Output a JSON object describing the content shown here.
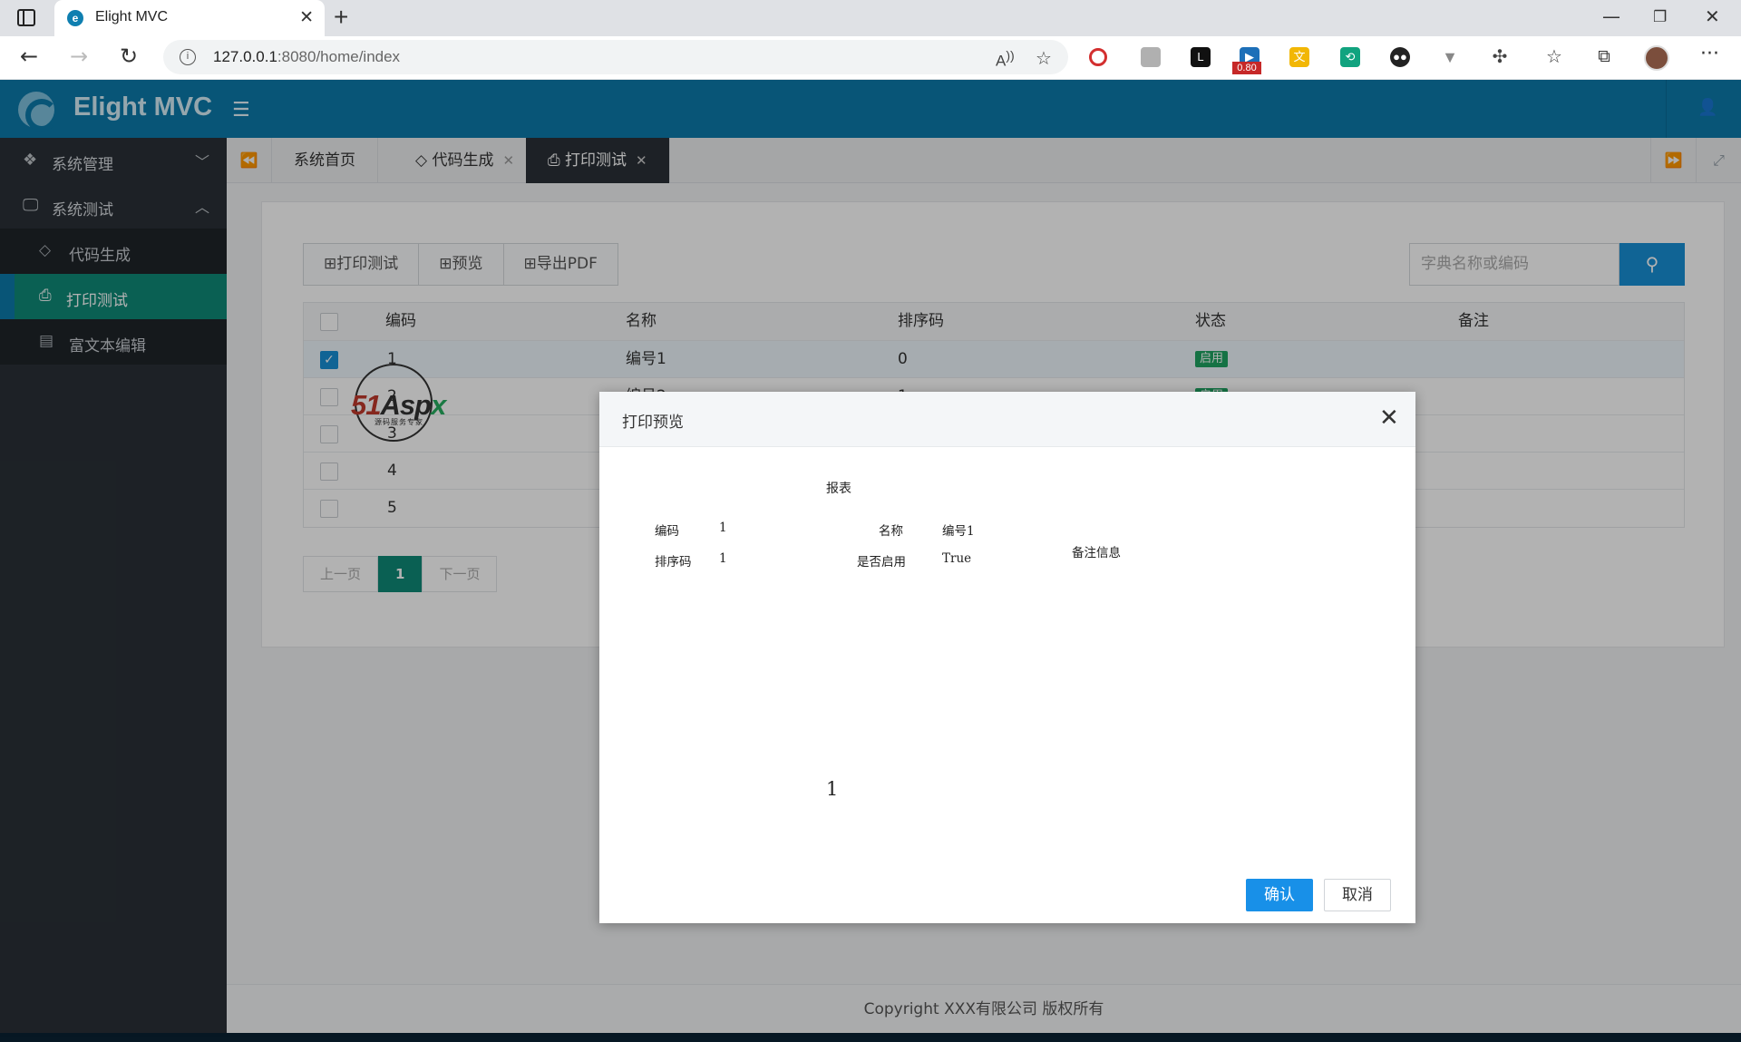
{
  "browser": {
    "tab_title": "Elight MVC",
    "url_host": "127.0.0.1",
    "url_path": ":8080/home/index",
    "ext_badge": "0.80",
    "icons": [
      "back-icon",
      "forward-icon",
      "refresh-icon",
      "info-icon",
      "read-aloud-icon",
      "add-favorite-icon",
      "favorites-icon",
      "collections-icon",
      "more-icon"
    ]
  },
  "app": {
    "title": "Elight MVC",
    "brand_color": "#0c7aab",
    "active_color": "#0f8a78"
  },
  "sidebar": {
    "groups": [
      {
        "label": "系统管理",
        "icon": "cubes-icon",
        "expanded": false
      },
      {
        "label": "系统测试",
        "icon": "desktop-icon",
        "expanded": true
      }
    ],
    "items": [
      {
        "label": "代码生成",
        "icon": "diamond-icon"
      },
      {
        "label": "打印测试",
        "icon": "print-icon",
        "active": true
      },
      {
        "label": "富文本编辑",
        "icon": "newspaper-icon"
      }
    ]
  },
  "tabs": [
    {
      "label": "系统首页"
    },
    {
      "label": "代码生成",
      "icon": "diamond-icon",
      "close": "✕"
    },
    {
      "label": "打印测试",
      "icon": "print-icon",
      "close": "✕",
      "active": true
    }
  ],
  "toolbar": {
    "print_test": "⊞打印测试",
    "preview": "⊞预览",
    "export_pdf": "⊞导出PDF",
    "search_placeholder": "字典名称或编码"
  },
  "table": {
    "headers": [
      "编码",
      "名称",
      "排序码",
      "状态",
      "备注"
    ],
    "rows": [
      {
        "code": "1",
        "name": "编号1",
        "sort": "0",
        "status": "启用",
        "checked": true
      },
      {
        "code": "2",
        "name": "编号2",
        "sort": "1",
        "status": "启用",
        "checked": false
      },
      {
        "code": "3",
        "name": "",
        "sort": "",
        "status": "",
        "checked": false
      },
      {
        "code": "4",
        "name": "",
        "sort": "",
        "status": "",
        "checked": false
      },
      {
        "code": "5",
        "name": "",
        "sort": "",
        "status": "",
        "checked": false
      }
    ]
  },
  "pager": {
    "prev": "上一页",
    "current": "1",
    "next": "下一页"
  },
  "footer": "Copyright XXX有限公司 版权所有",
  "modal": {
    "title": "打印预览",
    "report_title": "报表",
    "fields": {
      "code_label": "编码",
      "code_value": "1",
      "name_label": "名称",
      "name_value": "编号1",
      "sort_label": "排序码",
      "sort_value": "1",
      "enabled_label": "是否启用",
      "enabled_value": "True",
      "remark": "备注信息"
    },
    "page_number": "1",
    "ok": "确认",
    "cancel": "取消"
  },
  "watermark": {
    "brand": "51Aspx",
    "tagline": "源码服务专家"
  }
}
